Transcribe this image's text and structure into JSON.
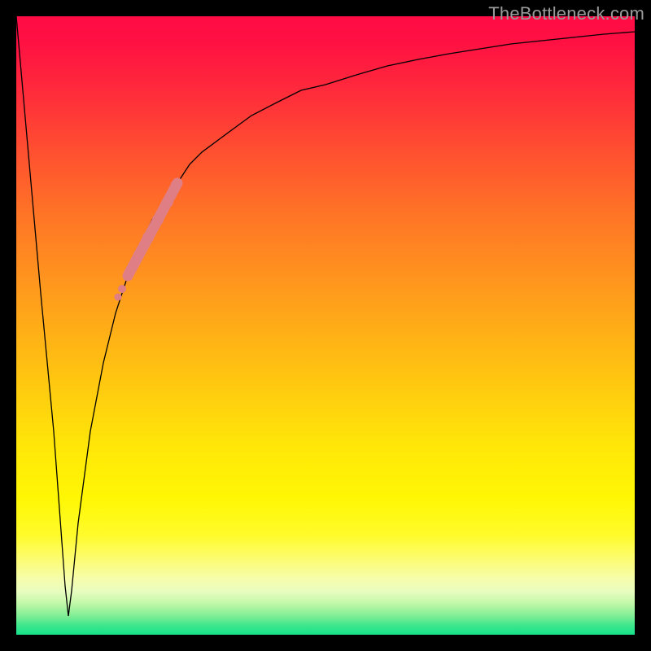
{
  "watermark": {
    "text": "TheBottleneck.com"
  },
  "colors": {
    "gradient_top": "#ff0b45",
    "gradient_mid": "#ffd000",
    "gradient_bottom": "#16e28a",
    "curve": "#000000",
    "blob": "#e07e86",
    "border": "#000000",
    "watermark": "#9a9a9a"
  },
  "chart_data": {
    "type": "line",
    "title": "",
    "xlabel": "",
    "ylabel": "",
    "xlim": [
      0,
      100
    ],
    "ylim": [
      0,
      100
    ],
    "grid": false,
    "legend": false,
    "annotations": [
      "TheBottleneck.com"
    ],
    "note": "V-shaped bottleneck curve: steeply descends from top-left to a minimum near x≈8.5 (y≈3), rises sharply then asymptotically approaches y≈98 toward the right. Salmon dotted segment highlights the curve between roughly x≈18 and x≈27.",
    "series": [
      {
        "name": "bottleneck-curve",
        "x": [
          0,
          2,
          4,
          6,
          8,
          8.5,
          9,
          10,
          12,
          14,
          16,
          18,
          20,
          22,
          24,
          26,
          28,
          30,
          34,
          38,
          42,
          46,
          50,
          55,
          60,
          65,
          70,
          75,
          80,
          85,
          90,
          95,
          100
        ],
        "y": [
          100,
          78,
          55,
          33,
          8,
          3,
          7,
          18,
          33,
          44,
          52,
          58,
          63,
          67,
          70,
          73,
          76,
          78,
          81,
          84,
          86,
          88,
          89,
          90.5,
          92,
          93,
          94,
          94.8,
          95.5,
          96.1,
          96.6,
          97.1,
          97.5
        ]
      },
      {
        "name": "highlight-blob",
        "x": [
          18,
          20,
          22,
          24,
          26,
          27
        ],
        "y": [
          58,
          63,
          67,
          70,
          73,
          75
        ]
      }
    ]
  }
}
